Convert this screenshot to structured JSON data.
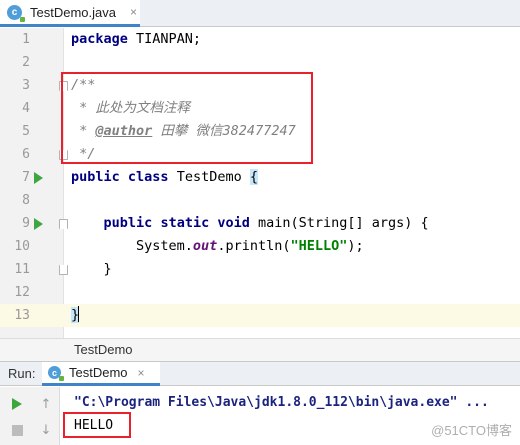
{
  "editor_tab": {
    "label": "TestDemo.java",
    "icon": "java-class-icon",
    "close": "×"
  },
  "editor": {
    "line_numbers": [
      "1",
      "2",
      "3",
      "4",
      "5",
      "6",
      "7",
      "8",
      "9",
      "10",
      "11",
      "12",
      "13"
    ],
    "lines": {
      "l1": {
        "kw": "package",
        "rest": " TIANPAN;"
      },
      "l3": {
        "text": "/**"
      },
      "l4": {
        "text": " * 此处为文档注释"
      },
      "l5": {
        "prefix": " * ",
        "tag": "@author",
        "rest": " 田攀 微信382477247"
      },
      "l6": {
        "text": " */"
      },
      "l7": {
        "kw1": "public",
        "kw2": "class",
        "name": " TestDemo ",
        "brace": "{"
      },
      "l9": {
        "kw1": "public",
        "kw2": "static",
        "kw3": "void",
        "rest": " main(String[] args) {"
      },
      "l10": {
        "pre": "        System.",
        "field": "out",
        "mid": ".println(",
        "str": "\"HELLO\"",
        "post": ");"
      },
      "l11": {
        "text": "    }"
      },
      "l13": {
        "brace": "}"
      }
    }
  },
  "breadcrumb": {
    "label": "TestDemo"
  },
  "run_panel": {
    "title": "Run:",
    "tab_label": "TestDemo",
    "tab_close": "×",
    "command": "\"C:\\Program Files\\Java\\jdk1.8.0_112\\bin\\java.exe\" ...",
    "output": "HELLO",
    "up_arrow": "↑",
    "down_arrow": "↓"
  },
  "watermark": "@51CTO博客",
  "colors": {
    "highlight_box": "#e8212a",
    "run_green": "#3fa63f",
    "keyword": "#000080",
    "string": "#008000"
  }
}
